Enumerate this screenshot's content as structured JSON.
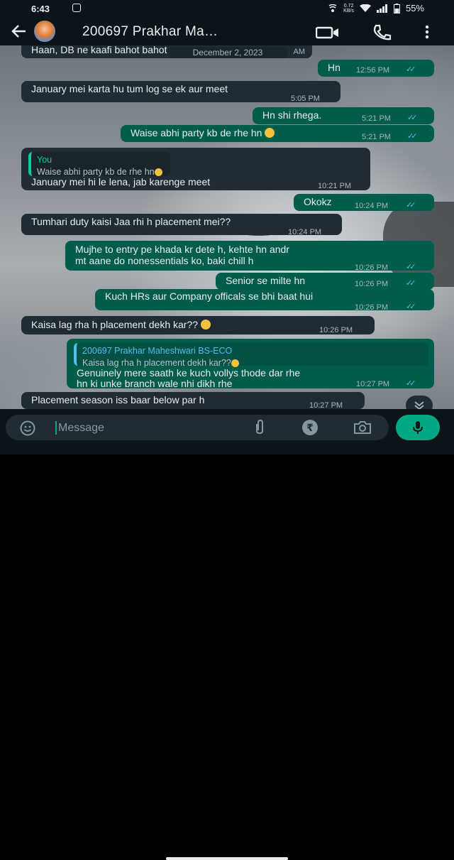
{
  "status": {
    "time": "6:43",
    "kbs_value": "0.72",
    "kbs_unit": "KB/s",
    "battery": "55%"
  },
  "header": {
    "title": "200697 Prakhar Ma…"
  },
  "date_chip": "December 2, 2023",
  "messages": [
    {
      "text": "Haan, DB ne kaafi bahot bahot",
      "ts": "AM"
    },
    {
      "text": "Hn",
      "ts": "12:56 PM"
    },
    {
      "text": "January mei karta hu tum log se ek aur meet",
      "ts": "5:05 PM"
    },
    {
      "text": "Hn shi rhega.",
      "ts": "5:21 PM"
    },
    {
      "text": "Waise abhi party kb de rhe hn",
      "ts": "5:21 PM"
    },
    {
      "quote_name": "You",
      "quote_text": "Waise abhi party kb de rhe hn",
      "text": "January mei hi le lena, jab karenge meet",
      "ts": "10:21 PM"
    },
    {
      "text": "Okokz",
      "ts": "10:24 PM"
    },
    {
      "text": "Tumhari duty kaisi Jaa rhi h placement mei??",
      "ts": "10:24 PM"
    },
    {
      "text1": "Mujhe to entry pe khada kr dete h, kehte hn andr",
      "text2": "mt aane do nonessentials ko, baki chill h",
      "ts": "10:26 PM"
    },
    {
      "text": "Senior se milte hn",
      "ts": "10:26 PM"
    },
    {
      "text": "Kuch HRs aur Company officals se bhi baat hui",
      "ts": "10:26 PM"
    },
    {
      "text": "Kaisa lag rha h placement dekh kar??",
      "ts": "10:26 PM"
    },
    {
      "quote_name": "200697 Prakhar Maheshwari BS-ECO",
      "quote_text": "Kaisa lag rha h placement dekh kar??",
      "text1": "Genuinely mere saath ke kuch vollys thode dar rhe",
      "text2": "hn ki unke branch wale nhi dikh rhe",
      "ts": "10:27 PM"
    },
    {
      "text": "Placement season iss baar below par h",
      "ts": "10:27 PM"
    }
  ],
  "input": {
    "placeholder": "Message"
  },
  "icons": {
    "read_receipt": "double-check-icon",
    "send": "mic-icon"
  },
  "colors": {
    "incoming": "#1f2c34",
    "outgoing": "#005c4b",
    "accent": "#00a884",
    "read_ticks": "#53bdeb"
  }
}
